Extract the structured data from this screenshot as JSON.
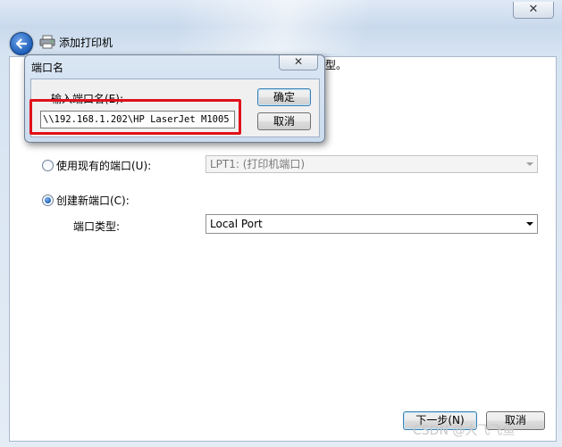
{
  "wizard": {
    "title": "添加打印机",
    "close_glyph": "✕",
    "description_tail": "类型。"
  },
  "options": {
    "use_existing_label": "使用现有的端口(U):",
    "existing_port_value": "LPT1: (打印机端口)",
    "create_new_label": "创建新端口(C):",
    "port_type_label": "端口类型:",
    "port_type_value": "Local Port"
  },
  "port_dialog": {
    "title": "端口名",
    "close_glyph": "✕",
    "input_label": "输入端口名(E):",
    "input_value": "\\\\192.168.1.202\\HP LaserJet M1005",
    "ok_label": "确定",
    "cancel_label": "取消"
  },
  "footer": {
    "next_label": "下一步(N)",
    "cancel_label": "取消"
  },
  "watermark": "CSDN @大飞飞鱼",
  "colors": {
    "highlight_box": "#e0101a",
    "accent_blue": "#1f5fb9"
  },
  "icons": {
    "back": "back-arrow-icon",
    "printer": "printer-icon",
    "close": "close-icon",
    "dropdown": "chevron-down-icon"
  }
}
